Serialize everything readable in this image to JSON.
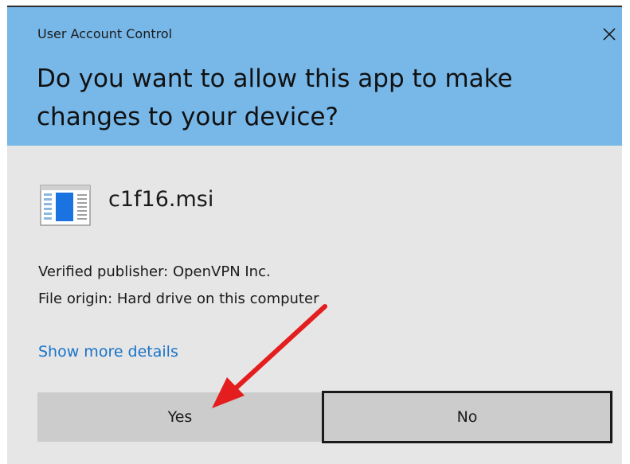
{
  "dialog": {
    "title": "User Account Control",
    "question": "Do you want to allow this app to make changes to your device?",
    "app_name": "c1f16.msi",
    "publisher": "Verified publisher: OpenVPN Inc.",
    "origin": "File origin: Hard drive on this computer",
    "details_link": "Show more details",
    "yes_label": "Yes",
    "no_label": "No"
  },
  "icons": {
    "close": "close-icon",
    "app": "installer-icon",
    "annotation": "red-arrow"
  },
  "colors": {
    "header_bg": "#78b8e8",
    "body_bg": "#e6e6e6",
    "link": "#1a73c8",
    "button_bg": "#cccccc",
    "arrow": "#e41e1e"
  }
}
